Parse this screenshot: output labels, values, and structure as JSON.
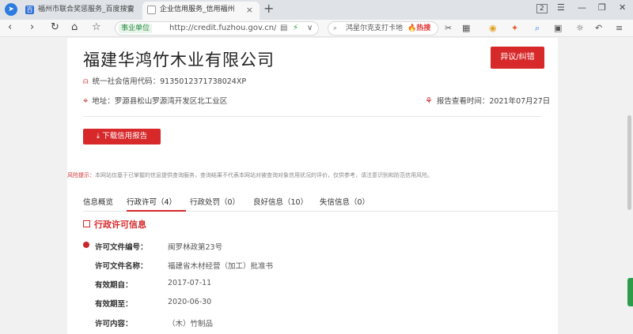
{
  "browser": {
    "tabs": [
      {
        "title": "福州市联合奖惩服务_百度搜索",
        "close": "×"
      },
      {
        "title": "企业信用服务_信用福州",
        "close": "×"
      }
    ],
    "new_tab": "+",
    "window_controls": {
      "counter": "2",
      "menu": "☰",
      "minimize": "—",
      "restore": "❐",
      "close": "✕"
    },
    "address": {
      "cert_label": "事业单位",
      "url": "http://credit.fuzhou.gov.cn/qyxy",
      "lightning": "⚡",
      "dropdown": "∨"
    },
    "search": {
      "query": "鸿星尔克支打卡地",
      "hot_label": "🔥热搜"
    }
  },
  "company": {
    "name": "福建华鸿竹木业有限公司",
    "objection_label": "异议/纠错",
    "credit_code_label": "统一社会信用代码：",
    "credit_code": "9135012371738024XP",
    "address_label": "地址：",
    "address": "罗源县松山罗源湾开发区北工业区",
    "report_time_label": "报告查看时间：",
    "report_time": "2021年07月27日",
    "download_label": "下载信用报告"
  },
  "risk": {
    "label": "风险提示：",
    "text": "本网站仅基于已掌握的信息提供查询服务，查询结果不代表本网站对被查询对象信用状况的评价，仅供参考，请注意识别和防范信用风险。"
  },
  "tabs": [
    {
      "label": "信息概览"
    },
    {
      "label": "行政许可（4）"
    },
    {
      "label": "行政处罚（0）"
    },
    {
      "label": "良好信息（10）"
    },
    {
      "label": "失信信息（0）"
    }
  ],
  "section": {
    "title": "行政许可信息",
    "fields": [
      {
        "label": "许可文件编号：",
        "value": "闽罗林政第23号"
      },
      {
        "label": "许可文件名称：",
        "value": "福建省木材经营（加工）批准书"
      },
      {
        "label": "有效期自：",
        "value": "2017-07-11"
      },
      {
        "label": "有效期至：",
        "value": "2020-06-30"
      },
      {
        "label": "许可内容：",
        "value": "（木）竹制品"
      }
    ]
  },
  "colors": {
    "accent": "#d7282a",
    "tab_bar": "#dfe3e8"
  }
}
